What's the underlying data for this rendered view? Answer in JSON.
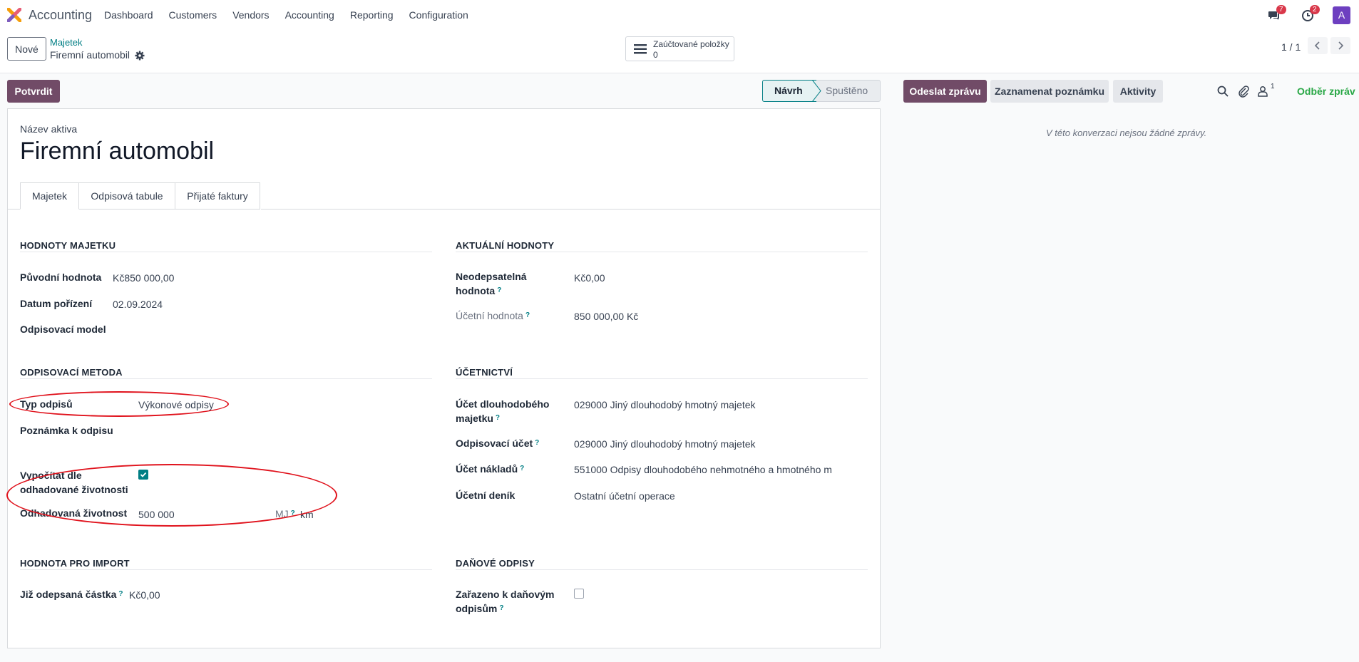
{
  "app": {
    "name": "Accounting"
  },
  "menu": [
    {
      "label": "Dashboard"
    },
    {
      "label": "Customers"
    },
    {
      "label": "Vendors"
    },
    {
      "label": "Accounting"
    },
    {
      "label": "Reporting"
    },
    {
      "label": "Configuration"
    }
  ],
  "nav": {
    "messages_count": "7",
    "activities_count": "2",
    "avatar": "A"
  },
  "control": {
    "new_label": "Nové",
    "breadcrumb_parent": "Majetek",
    "breadcrumb_current": "Firemní automobil",
    "smart_button": {
      "label": "Zaúčtované položky",
      "value": "0"
    },
    "pager": "1 / 1"
  },
  "actions": {
    "confirm": "Potvrdit"
  },
  "status": {
    "steps": [
      "Návrh",
      "Spuštěno"
    ],
    "active": "Návrh"
  },
  "chatter": {
    "send": "Odeslat zprávu",
    "note": "Zaznamenat poznámku",
    "activities": "Aktivity",
    "followers_count": "1",
    "follow": "Odběr zpráv",
    "empty": "V této konverzaci nejsou žádné zprávy."
  },
  "form": {
    "name_label": "Název aktiva",
    "name": "Firemní automobil",
    "tabs": [
      "Majetek",
      "Odpisová tabule",
      "Přijaté faktury"
    ],
    "sections": {
      "values": {
        "title": "Hodnoty majetku",
        "original_value_label": "Původní hodnota",
        "original_value": "Kč850 000,00",
        "acquisition_date_label": "Datum pořízení",
        "acquisition_date": "02.09.2024",
        "model_label": "Odpisovací model"
      },
      "current": {
        "title": "Aktuální hodnoty",
        "non_depr_label_1": "Neodepsatelná",
        "non_depr_label_2": "hodnota",
        "non_depr_value": "Kč0,00",
        "book_value_label": "Účetní hodnota",
        "book_value": "850 000,00 Kč"
      },
      "method": {
        "title": "Odpisovací metoda",
        "type_label": "Typ odpisů",
        "type_value": "Výkonové odpisy",
        "note_label": "Poznámka k odpisu",
        "compute_label_1": "Vypočítat dle",
        "compute_label_2": "odhadované životnosti",
        "compute_checked": true,
        "life_label": "Odhadovaná životnost",
        "life_value": "500 000",
        "unit_label": "MJ",
        "unit_value": "km"
      },
      "accounting": {
        "title": "Účetnictví",
        "asset_account_label_1": "Účet dlouhodobého",
        "asset_account_label_2": "majetku",
        "asset_account": "029000 Jiný dlouhodobý hmotný majetek",
        "depr_account_label": "Odpisovací účet",
        "depr_account": "029000 Jiný dlouhodobý hmotný majetek",
        "expense_account_label": "Účet nákladů",
        "expense_account": "551000 Odpisy dlouhodobého nehmotného a hmotného m",
        "journal_label": "Účetní deník",
        "journal": "Ostatní účetní operace"
      },
      "import": {
        "title": "Hodnota pro import",
        "already_label": "Již odepsaná částka",
        "already_value": "Kč0,00"
      },
      "tax": {
        "title": "Daňové odpisy",
        "included_label_1": "Zařazeno k daňovým",
        "included_label_2": "odpisům",
        "included_checked": false
      }
    }
  },
  "colors": {
    "primary": "#714b67",
    "accent": "#017e84",
    "annotation": "#e0121c"
  }
}
